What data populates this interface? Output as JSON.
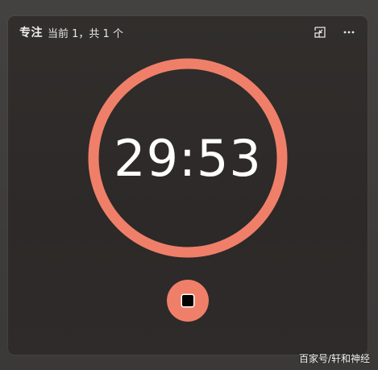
{
  "header": {
    "title": "专注",
    "subtitle": "当前 1，共 1 个",
    "icons": {
      "compact": "compact-overlay-icon",
      "more": "more-options-icon"
    }
  },
  "timer": {
    "time": "29:53",
    "ring_color": "#f07f69"
  },
  "controls": {
    "stop_icon": "stop-icon",
    "stop_color": "#f07f69"
  },
  "watermark": "百家号/轩和神经"
}
